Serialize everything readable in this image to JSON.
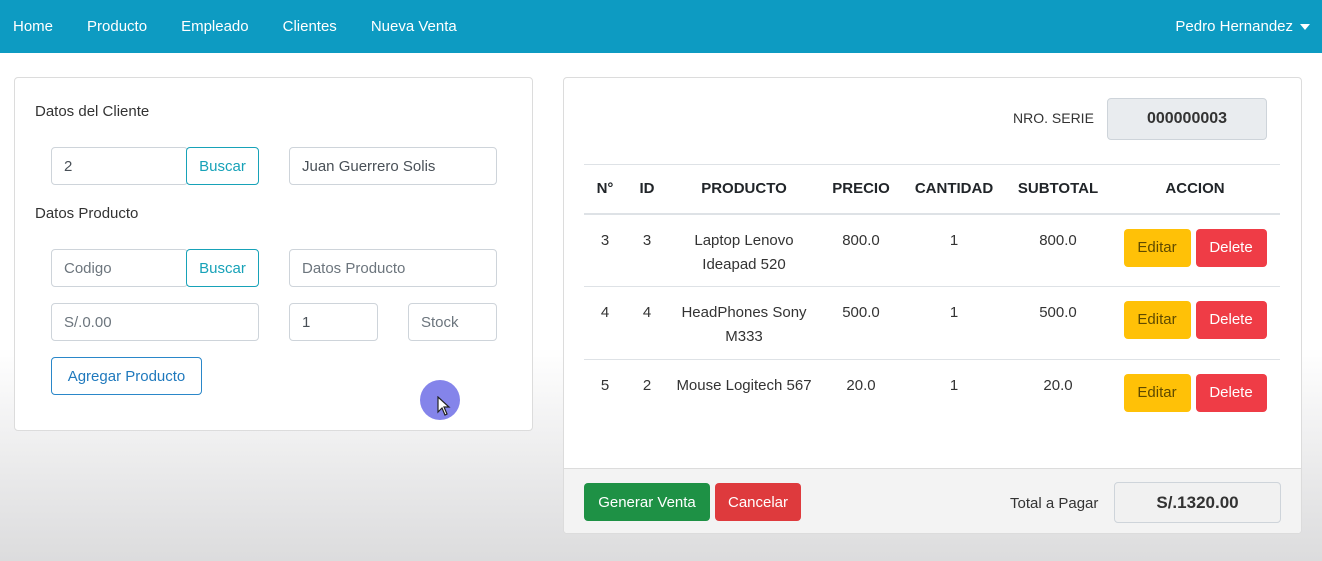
{
  "navbar": {
    "items": [
      "Home",
      "Producto",
      "Empleado",
      "Clientes",
      "Nueva Venta"
    ],
    "user": "Pedro Hernandez"
  },
  "cliente": {
    "section_label": "Datos del Cliente",
    "codigo_value": "2",
    "buscar_label": "Buscar",
    "nombre_value": "Juan Guerrero Solis"
  },
  "producto": {
    "section_label": "Datos Producto",
    "codigo_placeholder": "Codigo",
    "buscar_label": "Buscar",
    "datos_placeholder": "Datos Producto",
    "precio_placeholder": "S/.0.00",
    "cantidad_value": "1",
    "stock_placeholder": "Stock",
    "agregar_label": "Agregar Producto"
  },
  "venta": {
    "serie_label": "NRO. SERIE",
    "serie_value": "000000003",
    "columns": [
      "N°",
      "ID",
      "PRODUCTO",
      "PRECIO",
      "CANTIDAD",
      "SUBTOTAL",
      "ACCION"
    ],
    "rows": [
      {
        "n": "3",
        "id": "3",
        "producto": "Laptop Lenovo Ideapad 520",
        "precio": "800.0",
        "cantidad": "1",
        "subtotal": "800.0"
      },
      {
        "n": "4",
        "id": "4",
        "producto": "HeadPhones Sony M333",
        "precio": "500.0",
        "cantidad": "1",
        "subtotal": "500.0"
      },
      {
        "n": "5",
        "id": "2",
        "producto": "Mouse Logitech 567",
        "precio": "20.0",
        "cantidad": "1",
        "subtotal": "20.0"
      }
    ],
    "edit_label": "Editar",
    "delete_label": "Delete",
    "generar_label": "Generar Venta",
    "cancelar_label": "Cancelar",
    "total_label": "Total a Pagar",
    "total_value": "S/.1320.00"
  },
  "colors": {
    "navbar": "#0d9bc2",
    "edit": "#ffc107",
    "delete": "#ef3c46",
    "success": "#1e9145",
    "danger": "#de3a3d"
  }
}
